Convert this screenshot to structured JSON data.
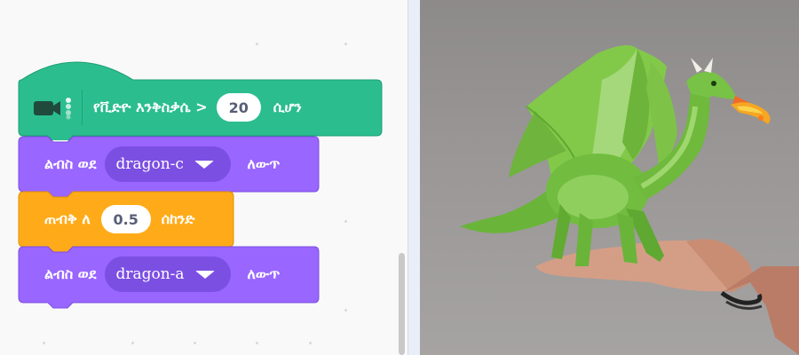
{
  "blocks": {
    "hat": {
      "label": "የቪድዮ እንቅስቃሴ >",
      "value": "20",
      "suffix": "ሲሆን",
      "icon": "video-camera-icon",
      "color": "#2bbd8e"
    },
    "switch_costume_1": {
      "label": "ልብስ ወደ",
      "dropdown_value": "dragon-c",
      "suffix": "ለውጥ",
      "color": "#9966ff"
    },
    "wait": {
      "label": "ጠብቅ ለ",
      "value": "0.5",
      "suffix": "ሰከንድ",
      "color": "#ffab19"
    },
    "switch_costume_2": {
      "label": "ልብስ ወደ",
      "dropdown_value": "dragon-a",
      "suffix": "ለውጥ",
      "color": "#9966ff"
    }
  },
  "stage": {
    "sprite": "dragon-sprite",
    "background": "video-feed-hand"
  }
}
